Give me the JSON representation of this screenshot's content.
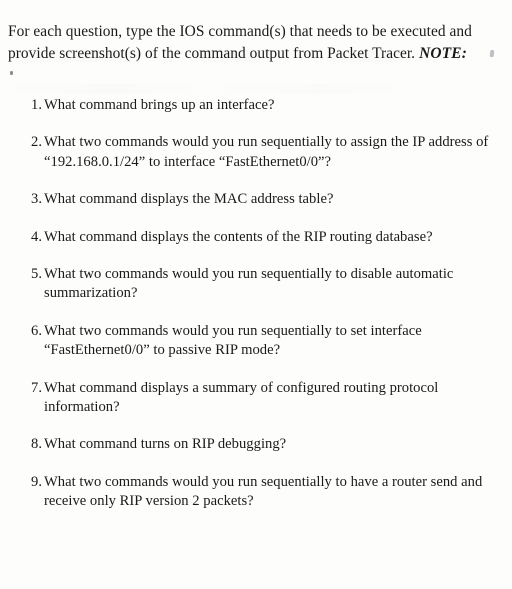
{
  "document": {
    "intro": {
      "text": "For each question, type the IOS command(s) that needs to be executed and provide screenshot(s) of the command output from Packet Tracer.",
      "note_label": "NOTE:"
    },
    "questions": [
      {
        "number": "1.",
        "text": "What command brings up an interface?"
      },
      {
        "number": "2.",
        "text": "What two commands would you run sequentially to assign the IP address of “192.168.0.1/24” to interface “FastEthernet0/0”?"
      },
      {
        "number": "3.",
        "text": "What command displays the MAC address table?"
      },
      {
        "number": "4.",
        "text": "What command displays the contents of the RIP routing database?"
      },
      {
        "number": "5.",
        "text": "What two commands would you run sequentially to disable automatic summarization?"
      },
      {
        "number": "6.",
        "text": "What two commands would you run sequentially to set interface “FastEthernet0/0” to passive RIP mode?"
      },
      {
        "number": "7.",
        "text": "What command displays a summary of configured routing protocol information?"
      },
      {
        "number": "8.",
        "text": "What command turns on RIP debugging?"
      },
      {
        "number": "9.",
        "text": "What two commands would you run sequentially to have a router send and receive only RIP version 2 packets?"
      }
    ]
  }
}
